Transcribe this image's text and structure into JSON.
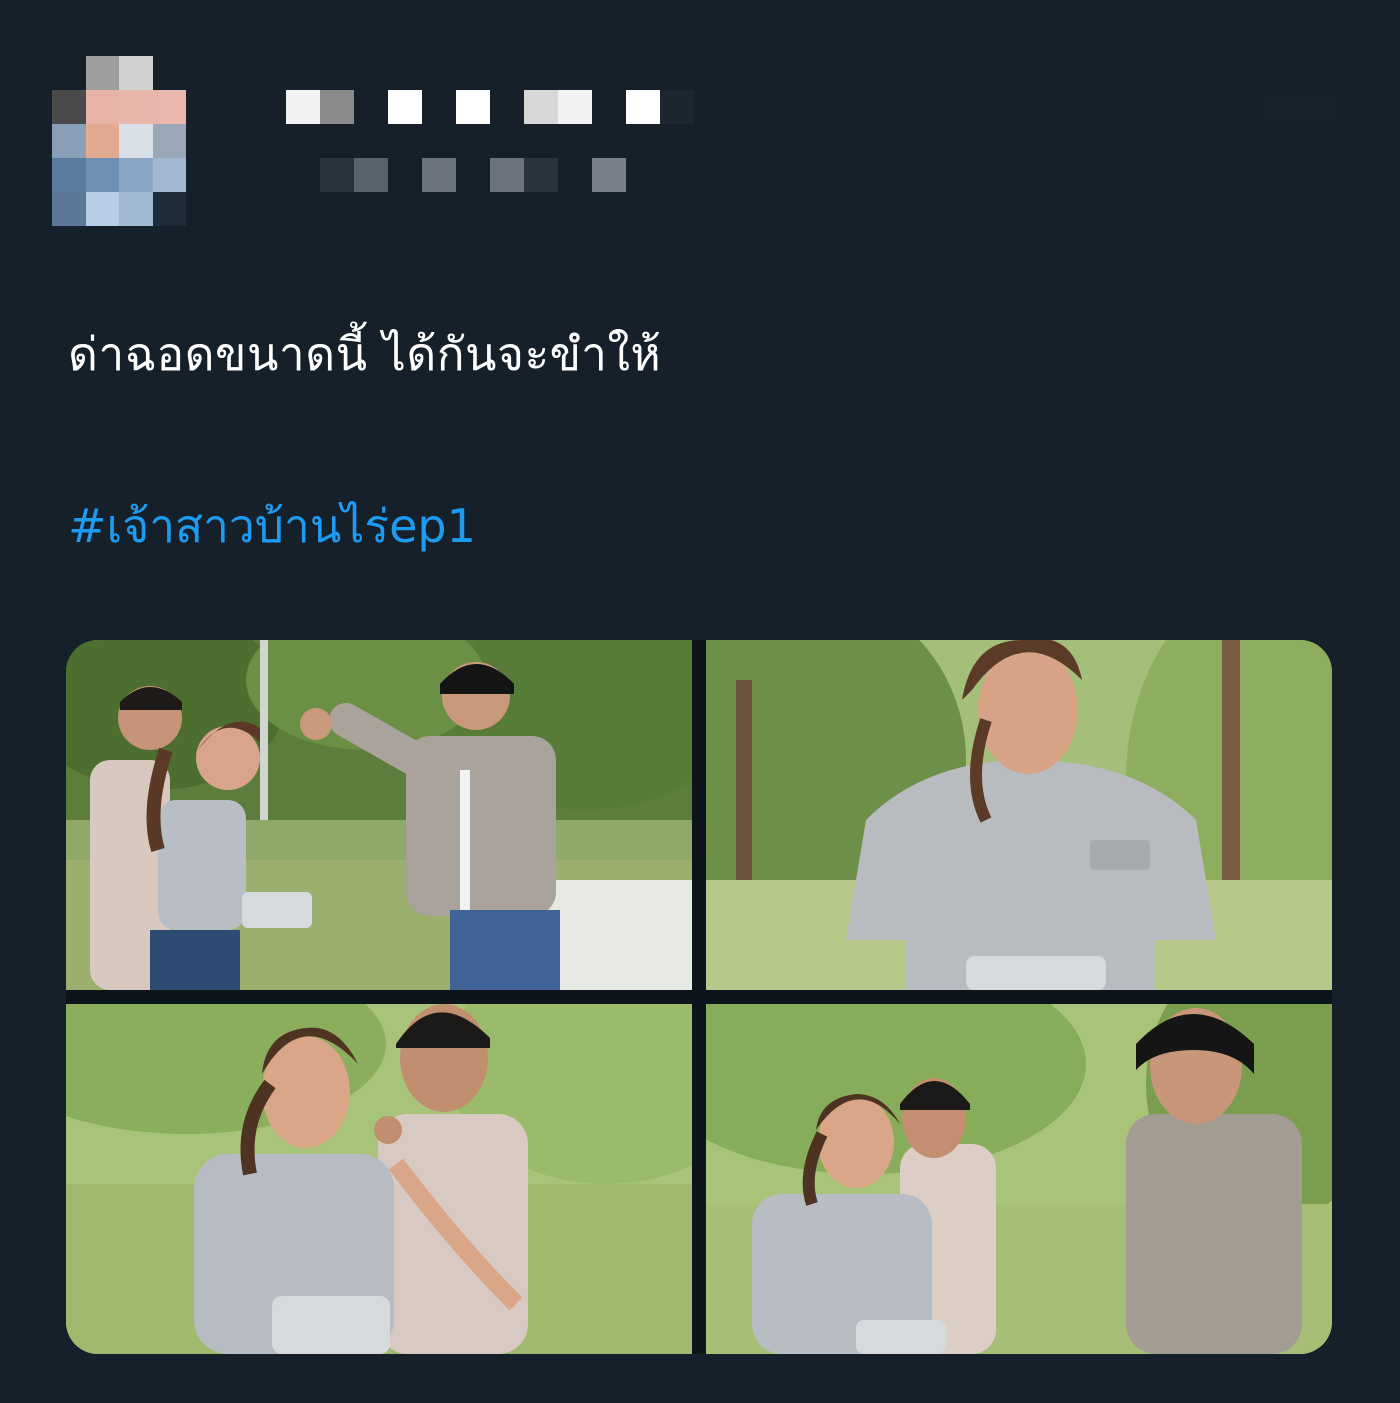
{
  "tweet": {
    "author_name": "",
    "author_handle": "",
    "text": "ด่าฉอดขนาดนี้ ได้กันจะขำให้",
    "hashtag": "#เจ้าสาวบ้านไร่ep1"
  },
  "media": {
    "photo_count": 4,
    "photos": [
      {
        "label": ""
      },
      {
        "label": ""
      },
      {
        "label": ""
      },
      {
        "label": ""
      }
    ]
  },
  "colors": {
    "background": "#15202b",
    "text": "#ffffff",
    "hashtag": "#1d9bf0"
  },
  "icons": {
    "avatar": "pixelated-avatar",
    "more": "more-options-icon"
  }
}
